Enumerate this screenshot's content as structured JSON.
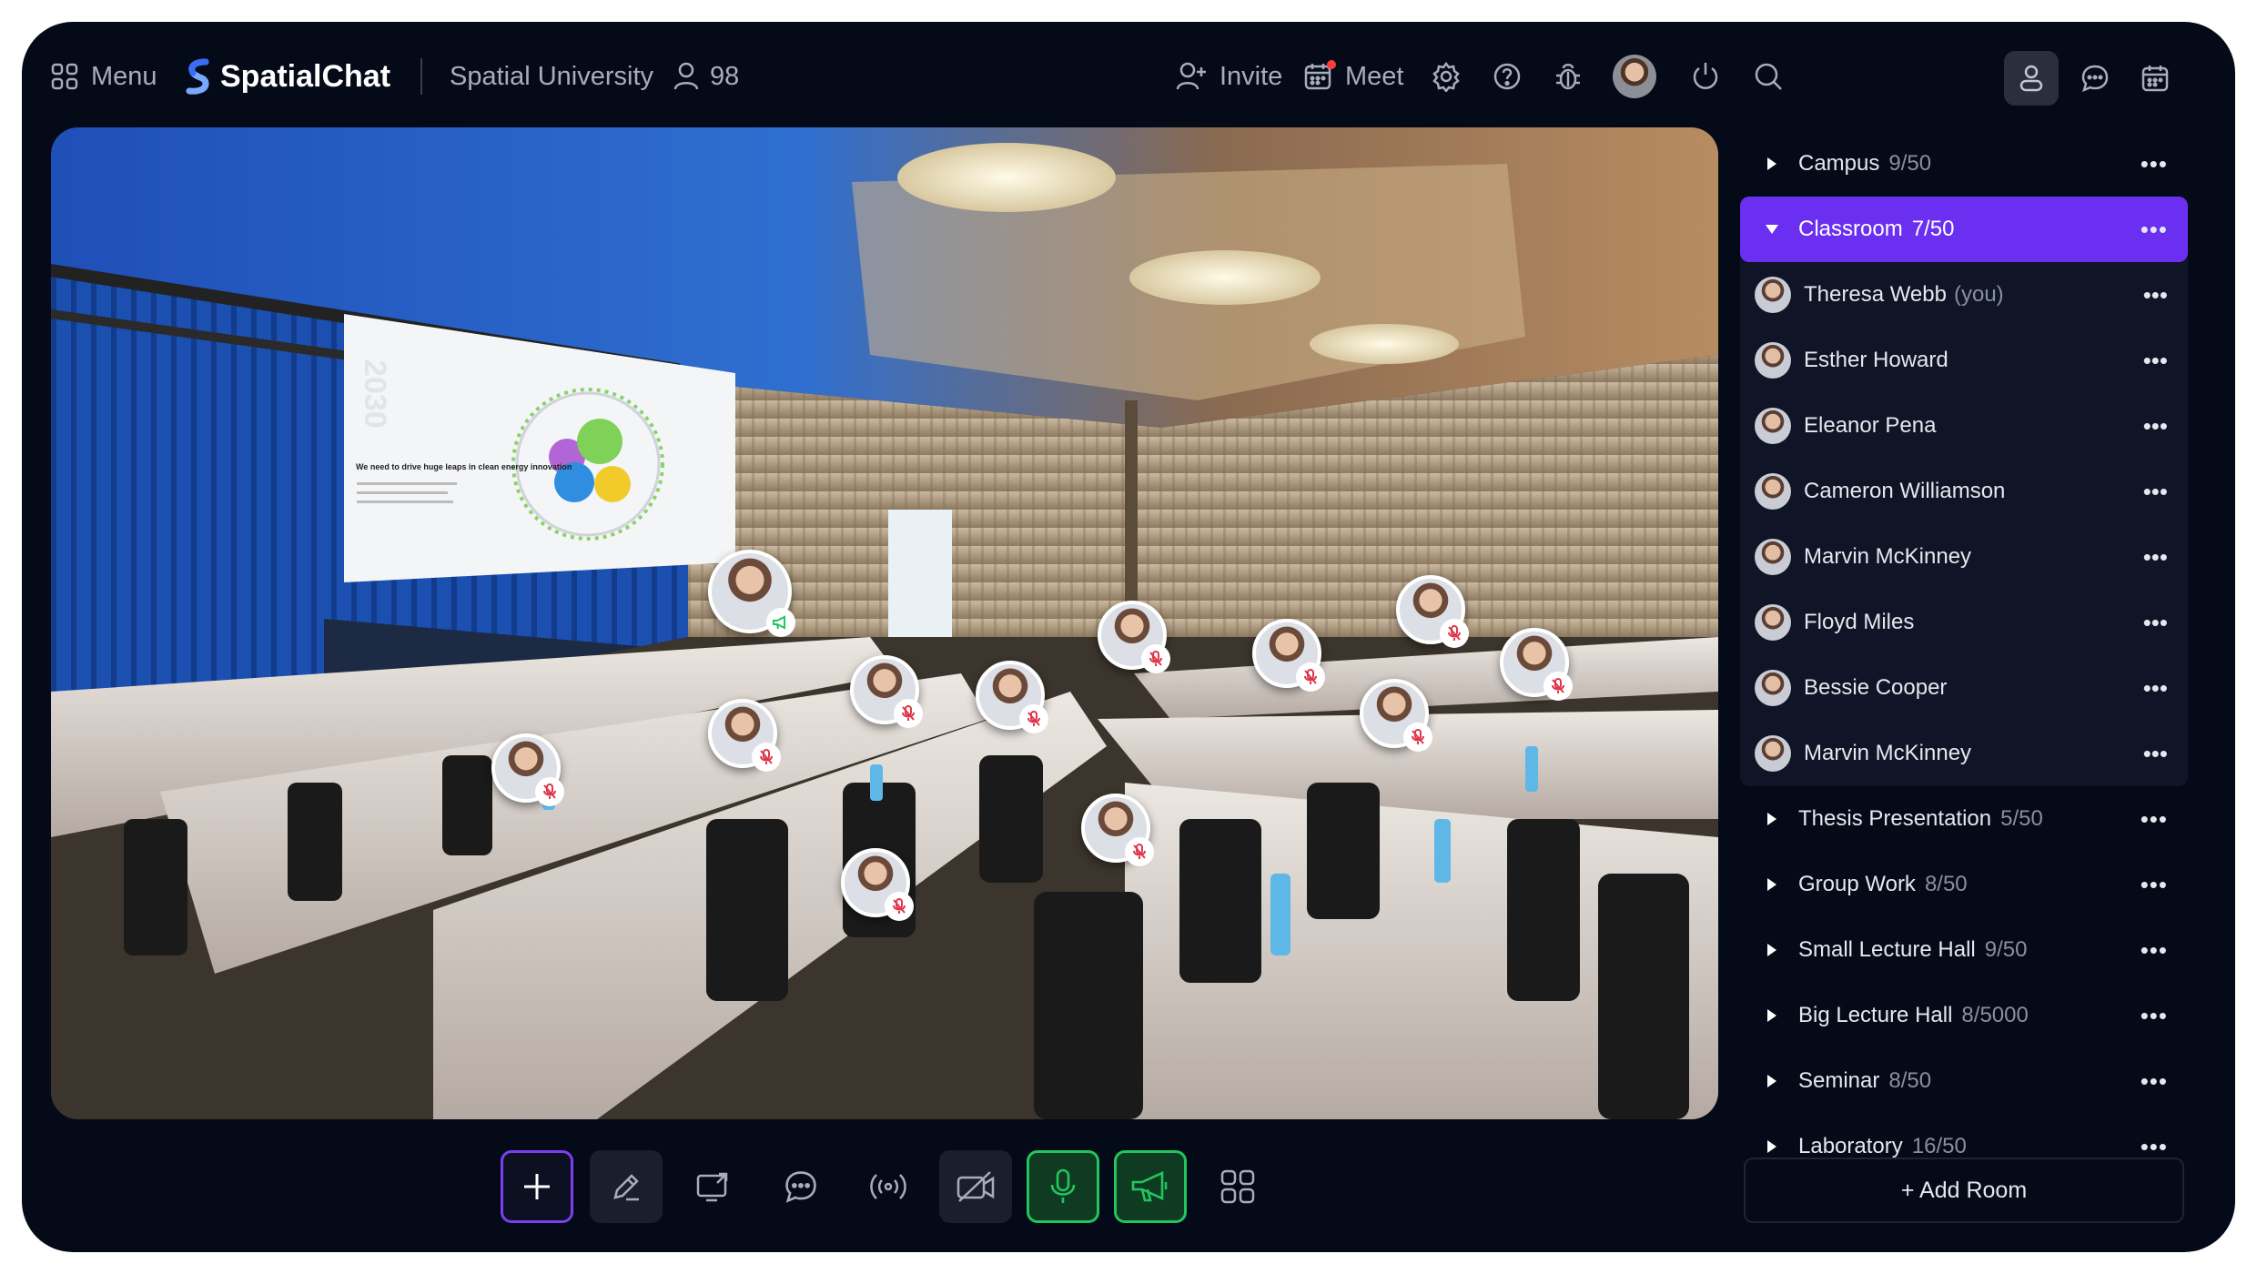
{
  "topbar": {
    "menu_label": "Menu",
    "brand": "SpatialChat",
    "space_name": "Spatial University",
    "participant_count": "98",
    "invite_label": "Invite",
    "meet_label": "Meet"
  },
  "rooms_before": [
    {
      "name": "Campus",
      "count": "9/50"
    }
  ],
  "active_room": {
    "name": "Classroom",
    "count": "7/50"
  },
  "members": [
    {
      "name": "Theresa Webb",
      "suffix": "(you)"
    },
    {
      "name": "Esther Howard",
      "suffix": ""
    },
    {
      "name": "Eleanor Pena",
      "suffix": ""
    },
    {
      "name": "Cameron Williamson",
      "suffix": ""
    },
    {
      "name": "Marvin McKinney",
      "suffix": ""
    },
    {
      "name": "Floyd Miles",
      "suffix": ""
    },
    {
      "name": "Bessie Cooper",
      "suffix": ""
    },
    {
      "name": "Marvin McKinney",
      "suffix": ""
    }
  ],
  "rooms_after": [
    {
      "name": "Thesis Presentation",
      "count": "5/50"
    },
    {
      "name": "Group Work",
      "count": "8/50"
    },
    {
      "name": "Small Lecture Hall",
      "count": "9/50"
    },
    {
      "name": "Big Lecture Hall",
      "count": "8/5000"
    },
    {
      "name": "Seminar",
      "count": "8/50"
    },
    {
      "name": "Laboratory",
      "count": "16/50"
    }
  ],
  "more_glyph": "•••",
  "add_room_label": "+ Add Room",
  "stage": {
    "year": "2030",
    "headline": "We need to drive huge leaps in clean energy innovation"
  },
  "colors": {
    "accent": "#6a2ff0",
    "active_green": "#22c55e",
    "frame": "#050a18"
  }
}
